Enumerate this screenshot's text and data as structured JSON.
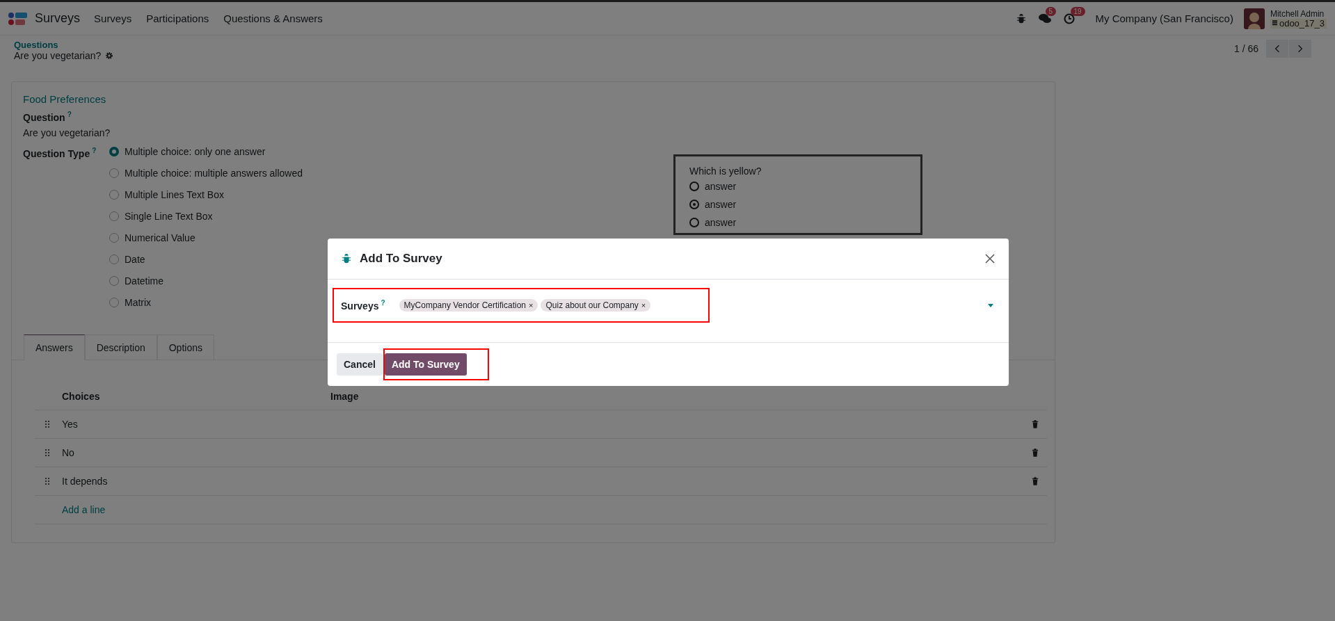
{
  "navbar": {
    "app_name": "Surveys",
    "menu": [
      "Surveys",
      "Participations",
      "Questions & Answers"
    ],
    "messages_badge": "5",
    "activities_badge": "19",
    "company": "My Company (San Francisco)",
    "user_name": "Mitchell Admin",
    "database": "odoo_17_3"
  },
  "breadcrumb": {
    "parent": "Questions",
    "current": "Are you vegetarian?"
  },
  "pager": {
    "text": "1 / 66"
  },
  "form": {
    "section": "Food Preferences",
    "question_label": "Question",
    "question_help": "?",
    "question_value": "Are you vegetarian?",
    "type_label": "Question Type",
    "type_help": "?",
    "types": [
      {
        "label": "Multiple choice: only one answer",
        "selected": true
      },
      {
        "label": "Multiple choice: multiple answers allowed",
        "selected": false
      },
      {
        "label": "Multiple Lines Text Box",
        "selected": false
      },
      {
        "label": "Single Line Text Box",
        "selected": false
      },
      {
        "label": "Numerical Value",
        "selected": false
      },
      {
        "label": "Date",
        "selected": false
      },
      {
        "label": "Datetime",
        "selected": false
      },
      {
        "label": "Matrix",
        "selected": false
      }
    ],
    "preview": {
      "title": "Which is yellow?",
      "options": [
        {
          "label": "answer",
          "selected": false
        },
        {
          "label": "answer",
          "selected": true
        },
        {
          "label": "answer",
          "selected": false
        }
      ]
    },
    "tabs": [
      {
        "label": "Answers",
        "selected": true
      },
      {
        "label": "Description",
        "selected": false
      },
      {
        "label": "Options",
        "selected": false
      }
    ],
    "answers": {
      "columns": [
        "Choices",
        "Image"
      ],
      "rows": [
        "Yes",
        "No",
        "It depends"
      ],
      "add_line": "Add a line"
    }
  },
  "dialog": {
    "title": "Add To Survey",
    "field": {
      "label": "Surveys",
      "help": "?",
      "highlighted": true,
      "tags": [
        {
          "label": "MyCompany Vendor Certification",
          "remove": "×"
        },
        {
          "label": "Quiz about our Company",
          "remove": "×"
        }
      ]
    },
    "buttons": [
      {
        "label": "Cancel",
        "kind": "secondary",
        "highlighted": false
      },
      {
        "label": "Add To Survey",
        "kind": "primary",
        "highlighted": true
      }
    ]
  }
}
